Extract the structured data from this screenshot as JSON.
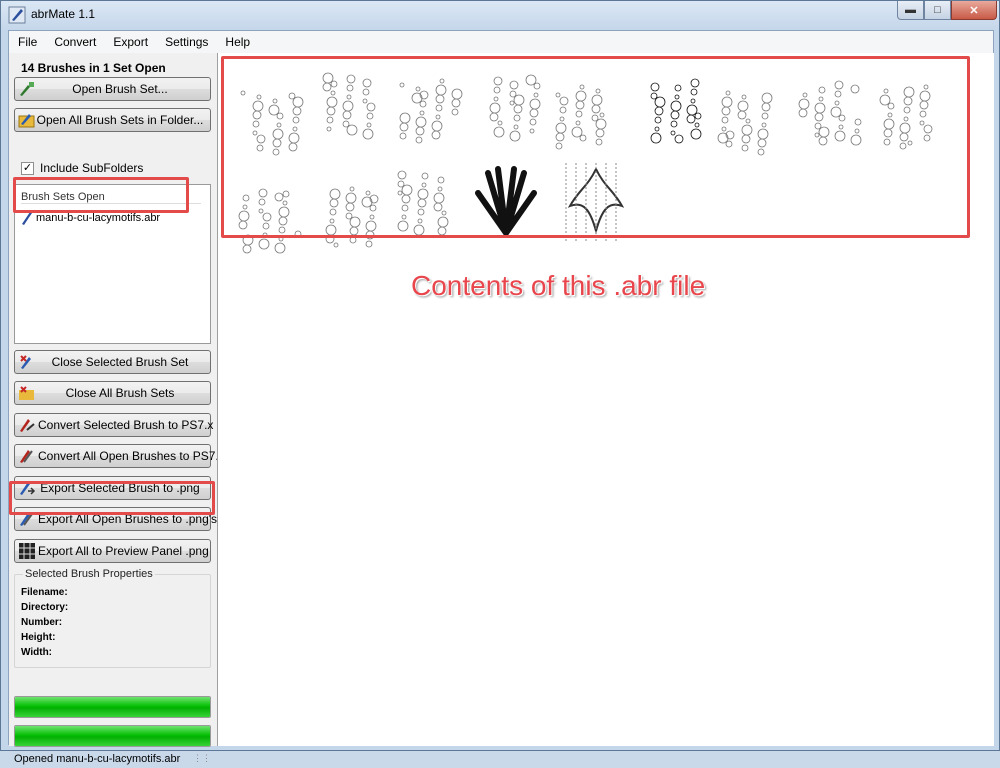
{
  "window": {
    "title": "abrMate 1.1"
  },
  "menu": [
    "File",
    "Convert",
    "Export",
    "Settings",
    "Help"
  ],
  "sidebar": {
    "heading": "14 Brushes in 1 Set Open",
    "open_brush_set": "Open Brush Set...",
    "open_all_in_folder": "Open All Brush Sets in Folder...",
    "include_subfolders": "Include SubFolders",
    "include_subfolders_checked": true,
    "brush_sets_header": "Brush Sets Open",
    "brush_sets": [
      "manu-b-cu-lacymotifs.abr"
    ],
    "close_selected": "Close Selected Brush Set",
    "close_all": "Close All Brush Sets",
    "convert_selected": "Convert Selected Brush to PS7.x",
    "convert_all": "Convert All Open Brushes to PS7.x",
    "export_selected": "Export Selected Brush to .png",
    "export_all_png": "Export All Open Brushes to .png's",
    "export_preview": "Export All to Preview Panel .png"
  },
  "properties": {
    "title": "Selected Brush Properties",
    "filename_label": "Filename:",
    "directory_label": "Directory:",
    "number_label": "Number:",
    "height_label": "Height:",
    "width_label": "Width:"
  },
  "progress": [
    1.0,
    1.0
  ],
  "status": "Opened manu-b-cu-lacymotifs.abr",
  "annotation_text": "Contents of this .abr file",
  "thumbnails": [
    "lace-border-arc",
    "crochet-flower",
    "scalloped-arc",
    "lace-column",
    "lace-panel",
    "doily-square",
    "scalloped-edging",
    "lace-square",
    "lace-medallion",
    "lace-trim-strip",
    "tassel-fringe",
    "lace-row",
    "feather-fan",
    "fleur-de-lis",
    "vertical-stitch-lines"
  ],
  "colors": {
    "annotation_red": "#e34a4a",
    "progress_green": "#06c006"
  }
}
